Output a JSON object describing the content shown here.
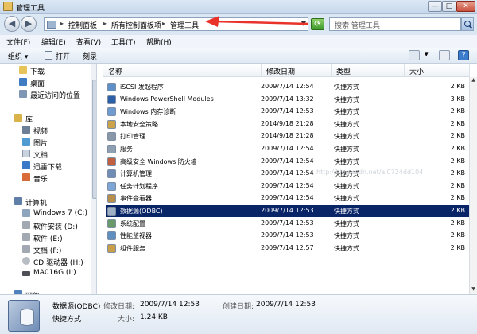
{
  "window": {
    "title": "管理工具",
    "minimize": "—",
    "maximize": "□",
    "close": "✕"
  },
  "address": {
    "crumbs": [
      "控制面板",
      "所有控制面板项",
      "管理工具"
    ],
    "search_placeholder": "搜索 管理工具"
  },
  "menu": [
    "文件(F)",
    "编辑(E)",
    "查看(V)",
    "工具(T)",
    "帮助(H)"
  ],
  "toolbar": {
    "organize": "组织 ▾",
    "open": "打开",
    "burn": "刻录"
  },
  "nav": {
    "items": [
      {
        "label": "下载",
        "icon": "folder-icon",
        "color": "#e7c45a"
      },
      {
        "label": "桌面",
        "icon": "desktop-icon",
        "color": "#3f7cc4"
      },
      {
        "label": "最近访问的位置",
        "icon": "recent-icon",
        "color": "#7f96b4"
      },
      {
        "label": "库",
        "icon": "library-icon",
        "color": "#d9b24a"
      },
      {
        "label": "视频",
        "icon": "video-icon",
        "color": "#6c7f96"
      },
      {
        "label": "图片",
        "icon": "pictures-icon",
        "color": "#4f9bd2"
      },
      {
        "label": "文档",
        "icon": "documents-icon",
        "color": "#c9d3df"
      },
      {
        "label": "迅雷下载",
        "icon": "thunder-icon",
        "color": "#3a78c8"
      },
      {
        "label": "音乐",
        "icon": "music-icon",
        "color": "#d96b3a"
      },
      {
        "label": "计算机",
        "icon": "computer-icon",
        "color": "#5f7fa8"
      },
      {
        "label": "Windows 7  (C:)",
        "icon": "drive-icon",
        "color": "#8fa4bd"
      },
      {
        "label": "软件安装  (D:)",
        "icon": "drive-icon",
        "color": "#a3a9b2"
      },
      {
        "label": "软件  (E:)",
        "icon": "drive-icon",
        "color": "#a3a9b2"
      },
      {
        "label": "文档  (F:)",
        "icon": "drive-icon",
        "color": "#a3a9b2"
      },
      {
        "label": "CD 驱动器  (H:)",
        "icon": "cd-drive-icon",
        "color": "#b8bcc3"
      },
      {
        "label": "MA016G  (I:)",
        "icon": "usb-drive-icon",
        "color": "#4d4f55"
      },
      {
        "label": "网络",
        "icon": "network-icon",
        "color": "#4f80bd"
      }
    ]
  },
  "columns": {
    "name": "名称",
    "date": "修改日期",
    "type": "类型",
    "size": "大小"
  },
  "files": [
    {
      "name": "iSCSI 发起程序",
      "date": "2009/7/14 12:54",
      "type": "快捷方式",
      "size": "2 KB",
      "icon": "iscsi-icon",
      "color": "#5d8fc8"
    },
    {
      "name": "Windows PowerShell Modules",
      "date": "2009/7/14 13:32",
      "type": "快捷方式",
      "size": "3 KB",
      "icon": "powershell-icon",
      "color": "#2b5fa8"
    },
    {
      "name": "Windows 内存诊断",
      "date": "2009/7/14 12:53",
      "type": "快捷方式",
      "size": "2 KB",
      "icon": "memory-diagnostic-icon",
      "color": "#6f9bd0"
    },
    {
      "name": "本地安全策略",
      "date": "2014/9/18 21:28",
      "type": "快捷方式",
      "size": "2 KB",
      "icon": "security-policy-icon",
      "color": "#c9a24a"
    },
    {
      "name": "打印管理",
      "date": "2014/9/18 21:28",
      "type": "快捷方式",
      "size": "2 KB",
      "icon": "printer-icon",
      "color": "#8a97a8"
    },
    {
      "name": "服务",
      "date": "2009/7/14 12:54",
      "type": "快捷方式",
      "size": "2 KB",
      "icon": "services-icon",
      "color": "#8fa0b3"
    },
    {
      "name": "高级安全 Windows 防火墙",
      "date": "2009/7/14 12:54",
      "type": "快捷方式",
      "size": "2 KB",
      "icon": "firewall-icon",
      "color": "#c0603e"
    },
    {
      "name": "计算机管理",
      "date": "2009/7/14 12:54",
      "type": "快捷方式",
      "size": "2 KB",
      "icon": "computer-management-icon",
      "color": "#6f8db5"
    },
    {
      "name": "任务计划程序",
      "date": "2009/7/14 12:54",
      "type": "快捷方式",
      "size": "2 KB",
      "icon": "task-scheduler-icon",
      "color": "#7ea6d6"
    },
    {
      "name": "事件查看器",
      "date": "2009/7/14 12:54",
      "type": "快捷方式",
      "size": "2 KB",
      "icon": "event-viewer-icon",
      "color": "#b88f4a"
    },
    {
      "name": "数据源(ODBC)",
      "date": "2009/7/14 12:53",
      "type": "快捷方式",
      "size": "2 KB",
      "icon": "odbc-icon",
      "color": "#9fb0c6",
      "selected": true
    },
    {
      "name": "系统配置",
      "date": "2009/7/14 12:53",
      "type": "快捷方式",
      "size": "2 KB",
      "icon": "system-config-icon",
      "color": "#6a9a6a"
    },
    {
      "name": "性能监视器",
      "date": "2009/7/14 12:53",
      "type": "快捷方式",
      "size": "2 KB",
      "icon": "performance-monitor-icon",
      "color": "#5f8fc0"
    },
    {
      "name": "组件服务",
      "date": "2009/7/14 12:57",
      "type": "快捷方式",
      "size": "2 KB",
      "icon": "component-services-icon",
      "color": "#c8a04a"
    }
  ],
  "watermark": "http://blog.csdn.net/ai0724dd104",
  "details": {
    "name": "数据源(ODBC)",
    "modified_label": "修改日期:",
    "modified": "2009/7/14 12:53",
    "created_label": "创建日期:",
    "created": "2009/7/14 12:53",
    "type": "快捷方式",
    "size_label": "大小:",
    "size": "1.24 KB"
  },
  "colors": {
    "selection": "#0a2468",
    "arrow": "#e8322a"
  }
}
